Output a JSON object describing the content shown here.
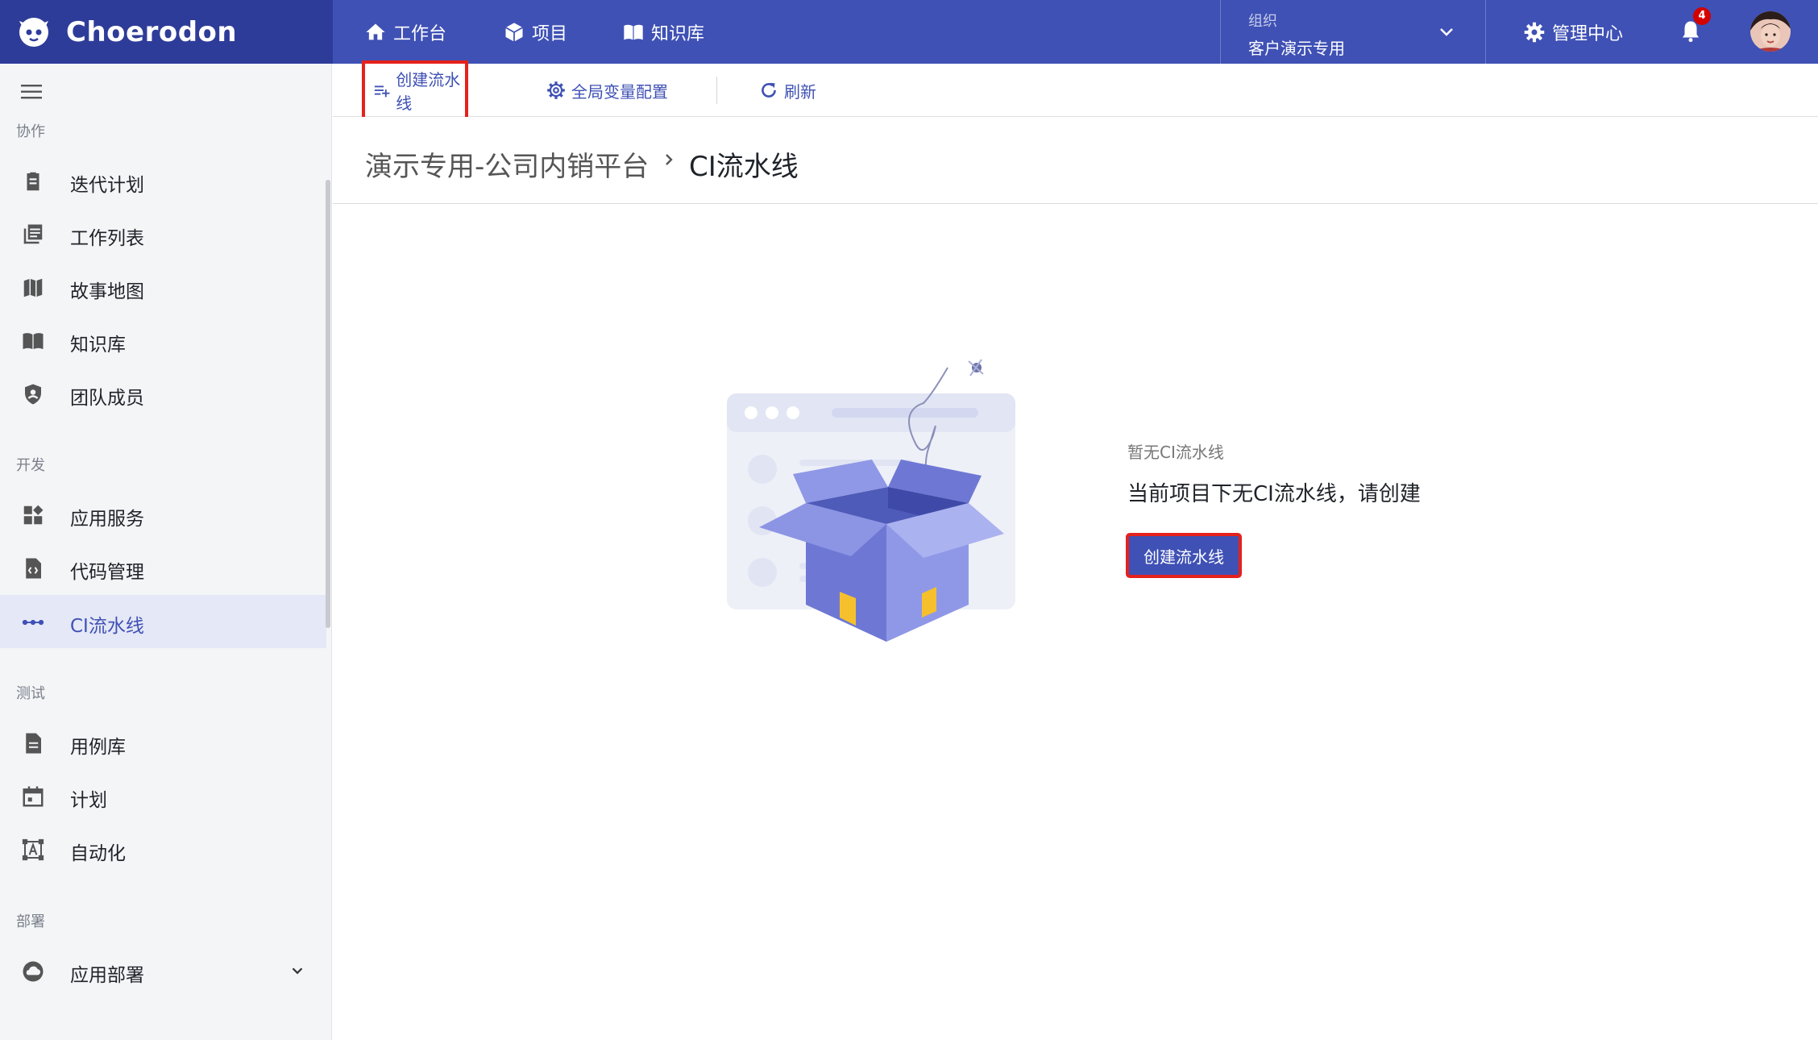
{
  "app": {
    "name": "Choerodon"
  },
  "topnav": {
    "items": [
      {
        "label": "工作台",
        "icon": "home-icon"
      },
      {
        "label": "项目",
        "icon": "cube-icon"
      },
      {
        "label": "知识库",
        "icon": "book-icon"
      }
    ],
    "org_label": "组织",
    "org_value": "客户演示专用",
    "admin_label": "管理中心",
    "notification_count": "4"
  },
  "sidebar": {
    "groups": [
      {
        "title": "协作",
        "items": [
          "迭代计划",
          "工作列表",
          "故事地图",
          "知识库",
          "团队成员"
        ]
      },
      {
        "title": "开发",
        "items": [
          "应用服务",
          "代码管理",
          "CI流水线"
        ]
      },
      {
        "title": "测试",
        "items": [
          "用例库",
          "计划",
          "自动化"
        ]
      },
      {
        "title": "部署",
        "items": [
          "应用部署"
        ]
      }
    ],
    "active_item": "CI流水线"
  },
  "toolbar": {
    "create_label": "创建流水线",
    "global_vars_label": "全局变量配置",
    "refresh_label": "刷新"
  },
  "breadcrumb": {
    "parent": "演示专用-公司内销平台",
    "current": "CI流水线"
  },
  "empty": {
    "subtitle": "暂无CI流水线",
    "title": "当前项目下无CI流水线，请创建",
    "button_label": "创建流水线"
  },
  "colors": {
    "primary": "#3f51b5",
    "brand_dark": "#2e3c99",
    "highlight": "#e5211c"
  }
}
